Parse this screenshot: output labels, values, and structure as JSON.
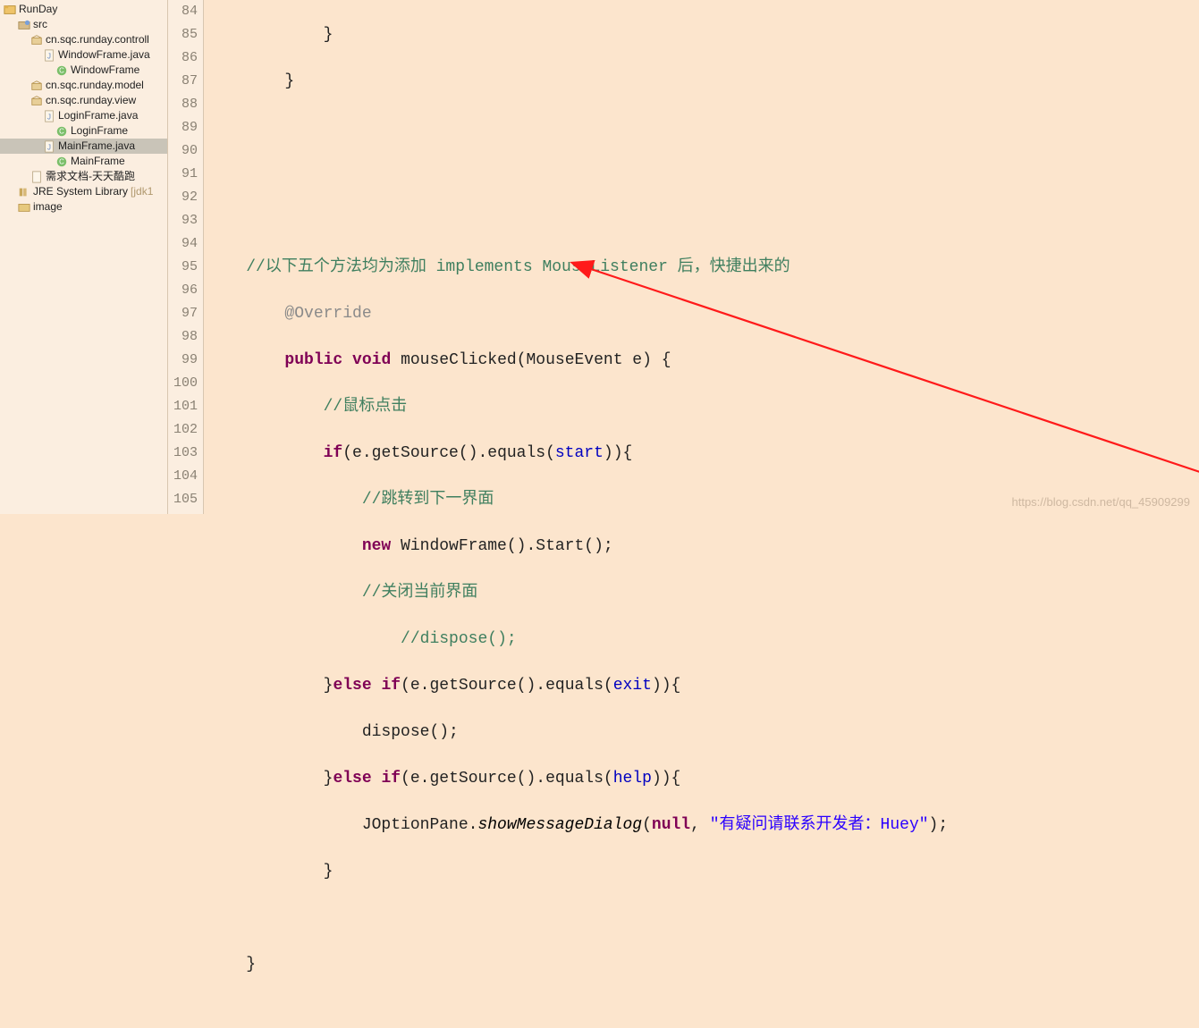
{
  "project": {
    "name": "RunDay",
    "src": "src",
    "pkg_ctrl": "cn.sqc.runday.controll",
    "file_wf": "WindowFrame.java",
    "cls_wf": "WindowFrame",
    "pkg_model": "cn.sqc.runday.model",
    "pkg_view": "cn.sqc.runday.view",
    "file_login": "LoginFrame.java",
    "cls_login": "LoginFrame",
    "file_main": "MainFrame.java",
    "cls_main": "MainFrame",
    "req_doc": "需求文档-天天酷跑",
    "jre": "JRE System Library",
    "jre_suffix": "[jdk1",
    "img": "image"
  },
  "ln": {
    "84": "84",
    "85": "85",
    "86": "86",
    "87": "87",
    "88": "88",
    "89": "89",
    "90": "90",
    "91": "91",
    "92": "92",
    "93": "93",
    "94": "94",
    "95": "95",
    "96": "96",
    "97": "97",
    "98": "98",
    "99": "99",
    "100": "100",
    "101": "101",
    "102": "102",
    "103": "103",
    "104": "104",
    "105": "105"
  },
  "code": {
    "l84": "            }",
    "l85": "        }",
    "l89cm": "//以下五个方法均为添加 implements MouseListener 后，快捷出来的",
    "override": "@Override",
    "kw_public": "public",
    "kw_void": "void",
    "kw_new": "new",
    "kw_else": "else",
    "kw_if": "if",
    "kw_null": "null",
    "mClicked": " mouseClicked(MouseEvent e) {",
    "l92cm": "//鼠标点击",
    "if1a": "(e.getSource().equals(",
    "if1b": "start",
    "if1c": ")){",
    "l94cm": "//跳转到下一界面",
    "l95a": " WindowFrame().Start();",
    "l96cm": "//关闭当前界面",
    "l97cm": "//dispose();",
    "ei_a": "}",
    "ei_b": "(e.getSource().equals(",
    "exit": "exit",
    "ei_c": ")){",
    "l99": "dispose();",
    "help": "help",
    "ei_d": ")){",
    "jop_a": "JOptionPane.",
    "jop_b": "showMessageDialog",
    "jop_c": "(",
    "jop_str": "\"有疑问请联系开发者：Huey\"",
    "jop_d": ", ",
    "jop_e": ");",
    "l102": "            }",
    "l104": "    }"
  },
  "watermark": "https://blog.csdn.net/qq_45909299"
}
